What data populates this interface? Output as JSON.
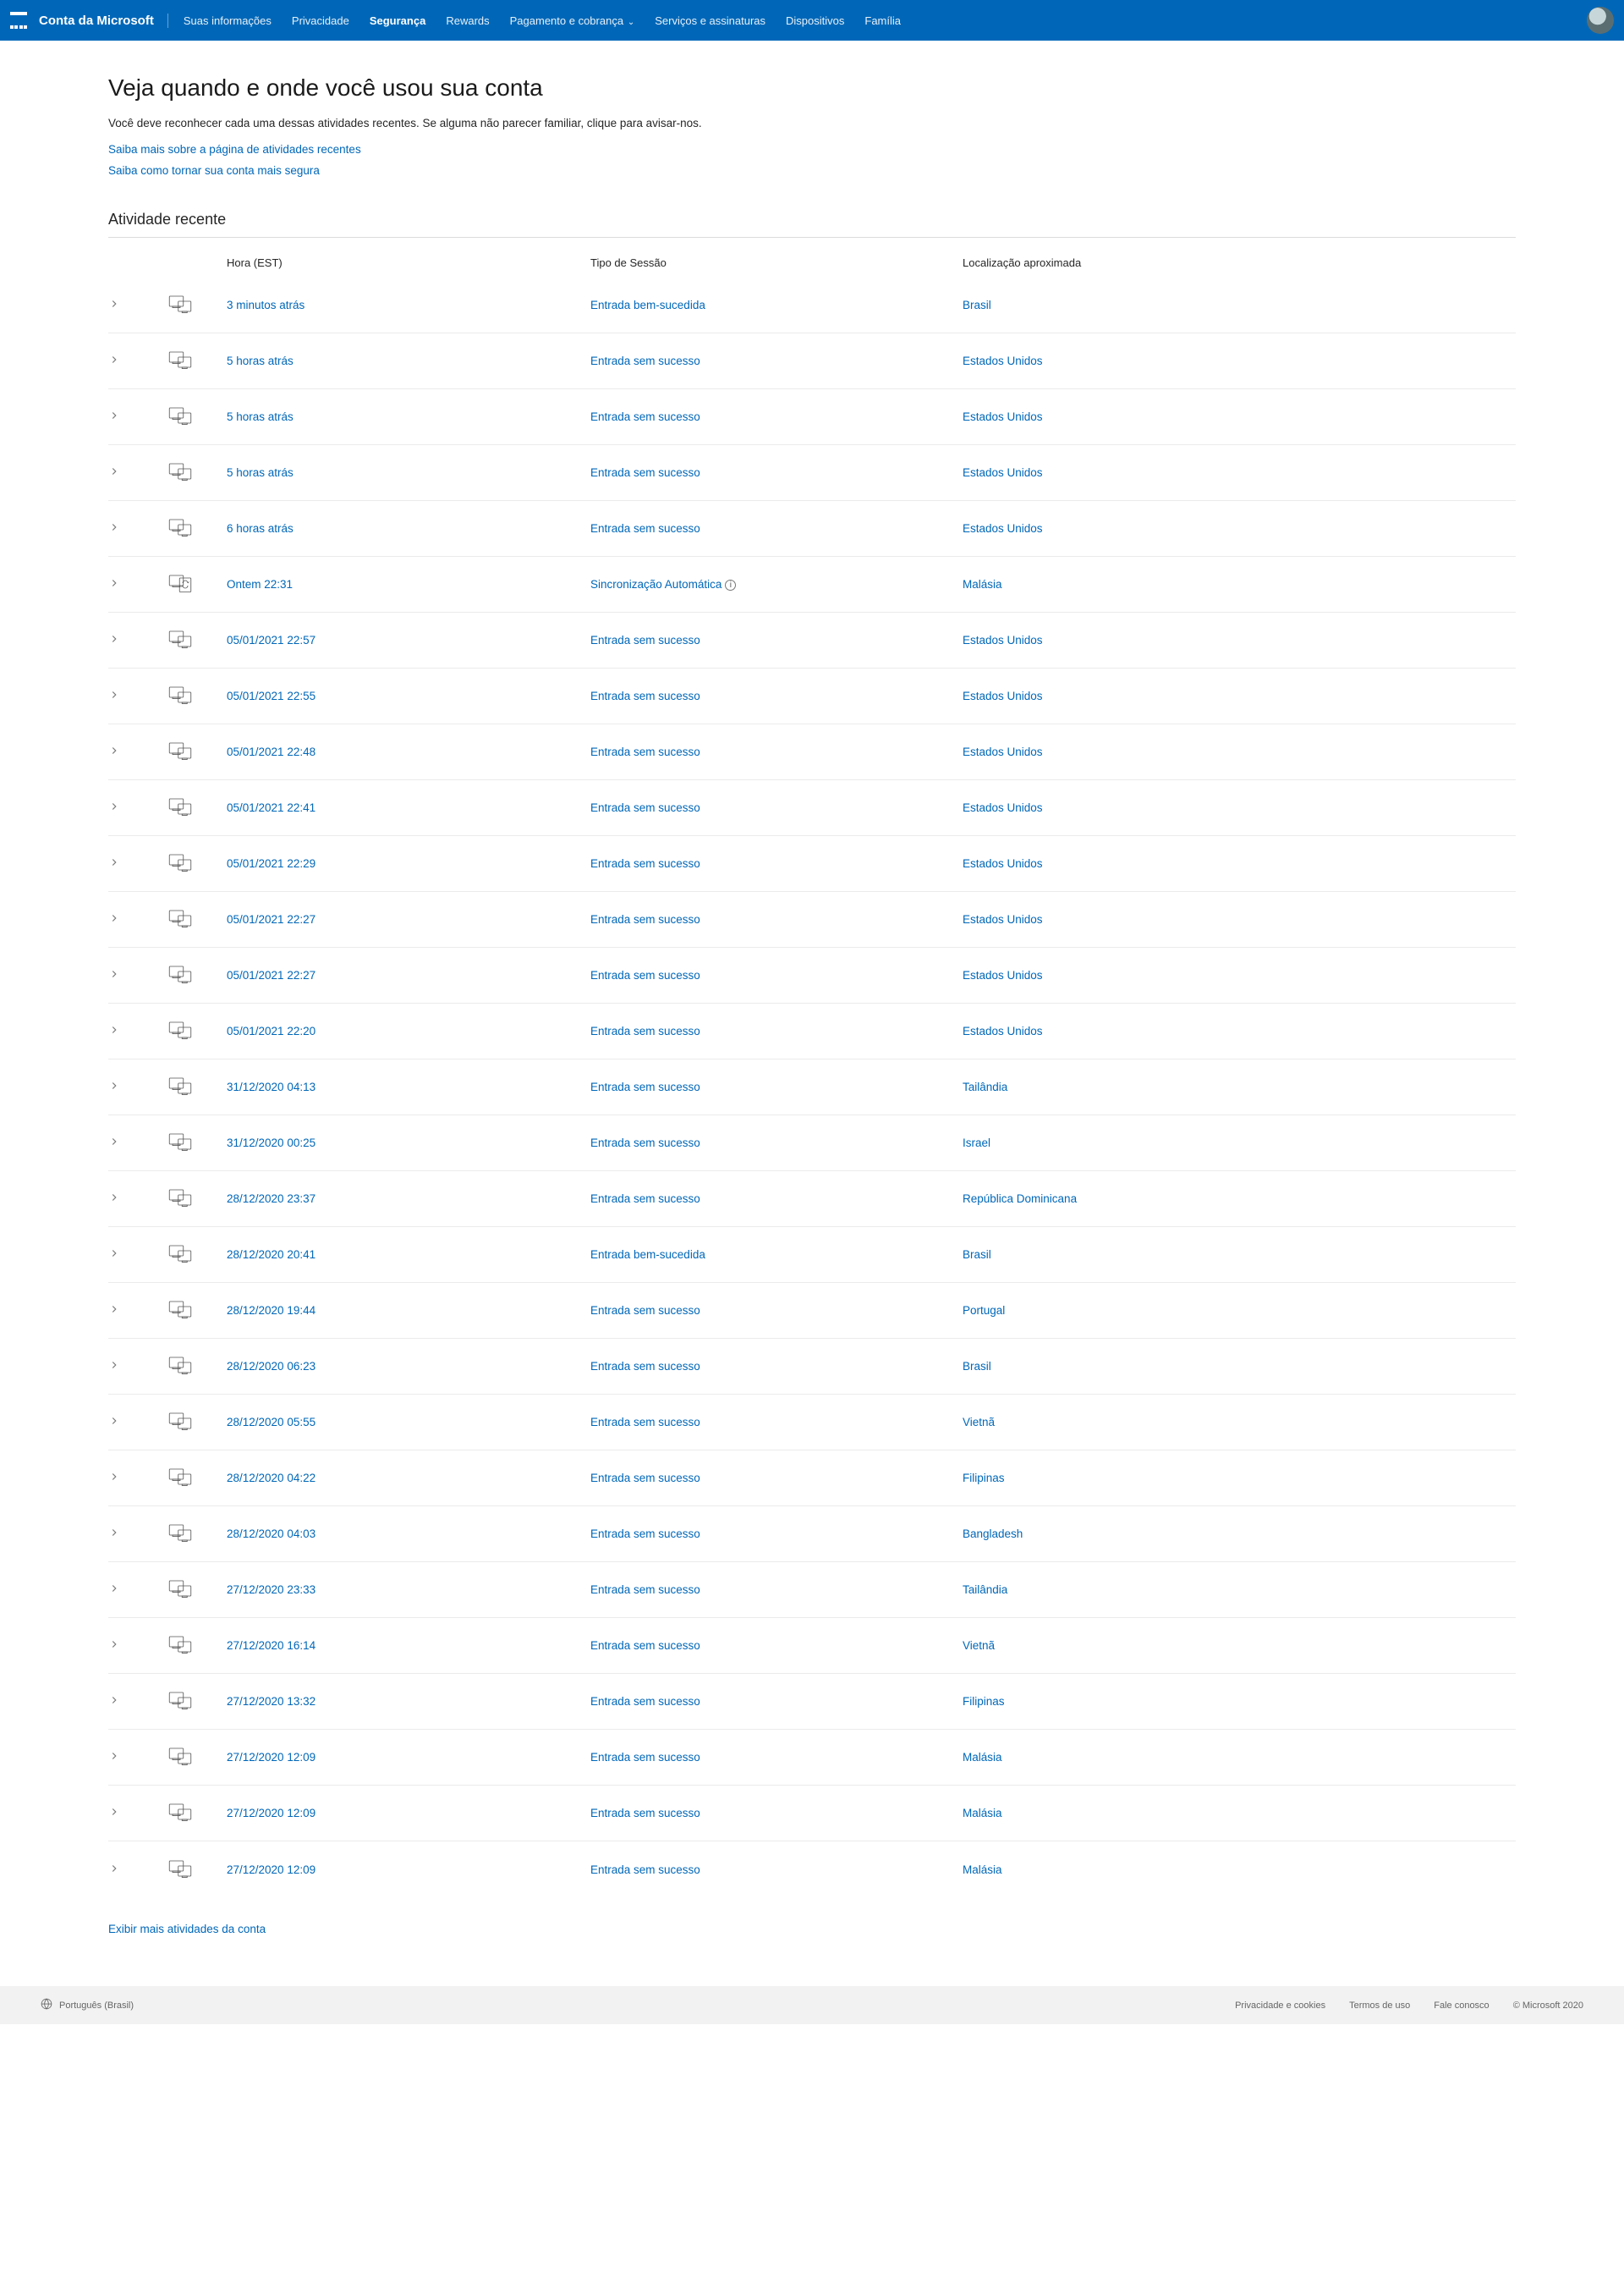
{
  "nav": {
    "brand": "Conta da Microsoft",
    "items": [
      {
        "label": "Suas informações",
        "active": false
      },
      {
        "label": "Privacidade",
        "active": false
      },
      {
        "label": "Segurança",
        "active": true
      },
      {
        "label": "Rewards",
        "active": false
      },
      {
        "label": "Pagamento e cobrança",
        "active": false,
        "hasDropdown": true
      },
      {
        "label": "Serviços e assinaturas",
        "active": false
      },
      {
        "label": "Dispositivos",
        "active": false
      },
      {
        "label": "Família",
        "active": false
      }
    ]
  },
  "page": {
    "title": "Veja quando e onde você usou sua conta",
    "intro": "Você deve reconhecer cada uma dessas atividades recentes. Se alguma não parecer familiar, clique para avisar-nos.",
    "link1": "Saiba mais sobre a página de atividades recentes",
    "link2": "Saiba como tornar sua conta mais segura",
    "sectionHeading": "Atividade recente",
    "columns": {
      "time": "Hora (EST)",
      "type": "Tipo de Sessão",
      "loc": "Localização aproximada"
    },
    "moreLink": "Exibir mais atividades da conta"
  },
  "activities": [
    {
      "time": "3 minutos atrás",
      "type": "Entrada bem-sucedida",
      "loc": "Brasil",
      "icon": "pc"
    },
    {
      "time": "5 horas atrás",
      "type": "Entrada sem sucesso",
      "loc": "Estados Unidos",
      "icon": "pc"
    },
    {
      "time": "5 horas atrás",
      "type": "Entrada sem sucesso",
      "loc": "Estados Unidos",
      "icon": "pc"
    },
    {
      "time": "5 horas atrás",
      "type": "Entrada sem sucesso",
      "loc": "Estados Unidos",
      "icon": "pc"
    },
    {
      "time": "6 horas atrás",
      "type": "Entrada sem sucesso",
      "loc": "Estados Unidos",
      "icon": "pc"
    },
    {
      "time": "Ontem 22:31",
      "type": "Sincronização Automática",
      "loc": "Malásia",
      "icon": "sync",
      "info": true
    },
    {
      "time": "05/01/2021 22:57",
      "type": "Entrada sem sucesso",
      "loc": "Estados Unidos",
      "icon": "pc"
    },
    {
      "time": "05/01/2021 22:55",
      "type": "Entrada sem sucesso",
      "loc": "Estados Unidos",
      "icon": "pc"
    },
    {
      "time": "05/01/2021 22:48",
      "type": "Entrada sem sucesso",
      "loc": "Estados Unidos",
      "icon": "pc"
    },
    {
      "time": "05/01/2021 22:41",
      "type": "Entrada sem sucesso",
      "loc": "Estados Unidos",
      "icon": "pc"
    },
    {
      "time": "05/01/2021 22:29",
      "type": "Entrada sem sucesso",
      "loc": "Estados Unidos",
      "icon": "pc"
    },
    {
      "time": "05/01/2021 22:27",
      "type": "Entrada sem sucesso",
      "loc": "Estados Unidos",
      "icon": "pc"
    },
    {
      "time": "05/01/2021 22:27",
      "type": "Entrada sem sucesso",
      "loc": "Estados Unidos",
      "icon": "pc"
    },
    {
      "time": "05/01/2021 22:20",
      "type": "Entrada sem sucesso",
      "loc": "Estados Unidos",
      "icon": "pc"
    },
    {
      "time": "31/12/2020 04:13",
      "type": "Entrada sem sucesso",
      "loc": "Tailândia",
      "icon": "pc"
    },
    {
      "time": "31/12/2020 00:25",
      "type": "Entrada sem sucesso",
      "loc": "Israel",
      "icon": "pc"
    },
    {
      "time": "28/12/2020 23:37",
      "type": "Entrada sem sucesso",
      "loc": "República Dominicana",
      "icon": "pc"
    },
    {
      "time": "28/12/2020 20:41",
      "type": "Entrada bem-sucedida",
      "loc": "Brasil",
      "icon": "pc"
    },
    {
      "time": "28/12/2020 19:44",
      "type": "Entrada sem sucesso",
      "loc": "Portugal",
      "icon": "pc"
    },
    {
      "time": "28/12/2020 06:23",
      "type": "Entrada sem sucesso",
      "loc": "Brasil",
      "icon": "pc"
    },
    {
      "time": "28/12/2020 05:55",
      "type": "Entrada sem sucesso",
      "loc": "Vietnã",
      "icon": "pc"
    },
    {
      "time": "28/12/2020 04:22",
      "type": "Entrada sem sucesso",
      "loc": "Filipinas",
      "icon": "pc"
    },
    {
      "time": "28/12/2020 04:03",
      "type": "Entrada sem sucesso",
      "loc": "Bangladesh",
      "icon": "pc"
    },
    {
      "time": "27/12/2020 23:33",
      "type": "Entrada sem sucesso",
      "loc": "Tailândia",
      "icon": "pc"
    },
    {
      "time": "27/12/2020 16:14",
      "type": "Entrada sem sucesso",
      "loc": "Vietnã",
      "icon": "pc"
    },
    {
      "time": "27/12/2020 13:32",
      "type": "Entrada sem sucesso",
      "loc": "Filipinas",
      "icon": "pc"
    },
    {
      "time": "27/12/2020 12:09",
      "type": "Entrada sem sucesso",
      "loc": "Malásia",
      "icon": "pc"
    },
    {
      "time": "27/12/2020 12:09",
      "type": "Entrada sem sucesso",
      "loc": "Malásia",
      "icon": "pc"
    },
    {
      "time": "27/12/2020 12:09",
      "type": "Entrada sem sucesso",
      "loc": "Malásia",
      "icon": "pc"
    }
  ],
  "footer": {
    "lang": "Português (Brasil)",
    "links": [
      "Privacidade e cookies",
      "Termos de uso",
      "Fale conosco"
    ],
    "copyright": "© Microsoft 2020"
  }
}
